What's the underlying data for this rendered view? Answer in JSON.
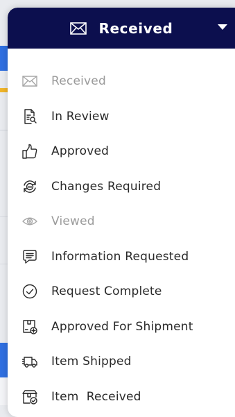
{
  "dropdown": {
    "selected": {
      "label": "Received",
      "icon": "envelope-icon"
    },
    "options": [
      {
        "label": "Received",
        "icon": "envelope-icon",
        "muted": true
      },
      {
        "label": "In Review",
        "icon": "document-search-icon",
        "muted": false
      },
      {
        "label": "Approved",
        "icon": "thumbs-up-icon",
        "muted": false
      },
      {
        "label": "Changes Required",
        "icon": "refresh-cycle-icon",
        "muted": false
      },
      {
        "label": "Viewed",
        "icon": "eye-icon",
        "muted": true
      },
      {
        "label": "Information Requested",
        "icon": "chat-bubble-icon",
        "muted": false
      },
      {
        "label": "Request Complete",
        "icon": "check-circle-icon",
        "muted": false
      },
      {
        "label": "Approved For Shipment",
        "icon": "package-add-icon",
        "muted": false
      },
      {
        "label": "Item Shipped",
        "icon": "delivery-truck-icon",
        "muted": false
      },
      {
        "label": "Item  Received",
        "icon": "package-received-icon",
        "muted": false
      }
    ]
  },
  "colors": {
    "header_bg": "#0c0f4e",
    "text": "#2a2a2a",
    "muted_text": "#9a9a9a",
    "accent_blue": "#2f6fe0",
    "accent_gold": "#f0b429"
  }
}
